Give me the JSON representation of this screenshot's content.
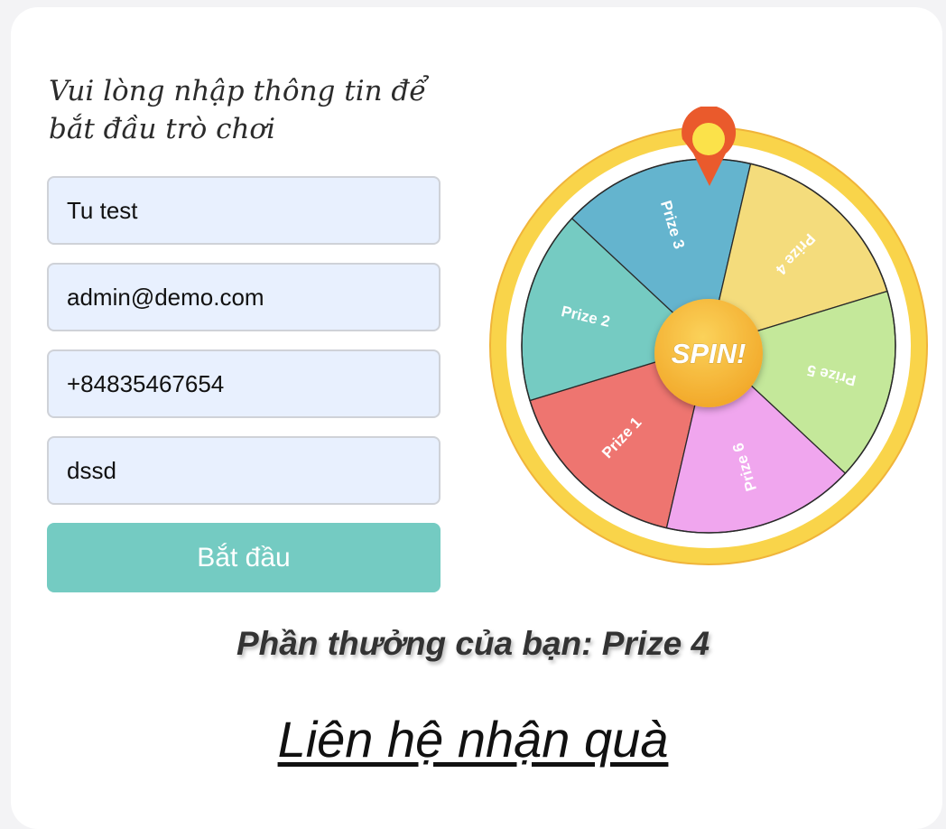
{
  "form": {
    "heading": "Vui lòng nhập thông tin để bắt đầu trò chơi",
    "name_value": "Tu test",
    "email_value": "admin@demo.com",
    "phone_value": "+84835467654",
    "note_value": "dssd",
    "start_button_label": "Bắt đầu"
  },
  "wheel": {
    "spin_label": "SPIN!",
    "segments": [
      {
        "label": "Prize 1",
        "color": "#ee7570"
      },
      {
        "label": "Prize 2",
        "color": "#75cbc2"
      },
      {
        "label": "Prize 3",
        "color": "#64b4ce"
      },
      {
        "label": "Prize 4",
        "color": "#f4dc7c"
      },
      {
        "label": "Prize 5",
        "color": "#c4e89a"
      },
      {
        "label": "Prize 6",
        "color": "#f0a6ee"
      }
    ],
    "rim_color": "#f9d44a",
    "pointer_color": "#ea5a2c",
    "hub_color": "#f5b432"
  },
  "result": {
    "prize_text": "Phần thưởng của bạn: Prize 4"
  },
  "contact": {
    "link_label": "Liên hệ nhận quà"
  }
}
